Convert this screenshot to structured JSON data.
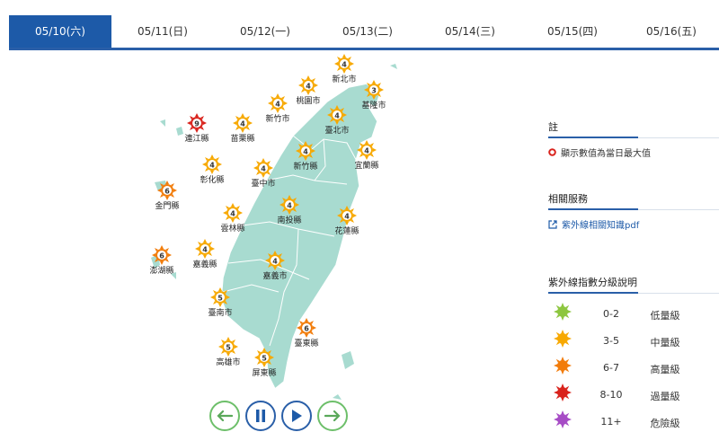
{
  "tabs": [
    {
      "label": "05/10(六)",
      "active": true
    },
    {
      "label": "05/11(日)",
      "active": false
    },
    {
      "label": "05/12(一)",
      "active": false
    },
    {
      "label": "05/13(二)",
      "active": false
    },
    {
      "label": "05/14(三)",
      "active": false
    },
    {
      "label": "05/15(四)",
      "active": false
    },
    {
      "label": "05/16(五)",
      "active": false
    }
  ],
  "colors": {
    "tab_active": "#1d5aa8",
    "land": "#a8dbd0",
    "low": "#8dc63f",
    "mid": "#f7a800",
    "high": "#f27c0a",
    "excess": "#d9231c",
    "danger": "#a64bc5"
  },
  "cities": [
    {
      "name": "新北市",
      "value": "4",
      "level": "mid"
    },
    {
      "name": "桃園市",
      "value": "4",
      "level": "mid"
    },
    {
      "name": "基隆市",
      "value": "3",
      "level": "mid"
    },
    {
      "name": "新竹市",
      "value": "4",
      "level": "mid"
    },
    {
      "name": "臺北市",
      "value": "4",
      "level": "mid"
    },
    {
      "name": "連江縣",
      "value": "9",
      "level": "excess"
    },
    {
      "name": "苗栗縣",
      "value": "4",
      "level": "mid"
    },
    {
      "name": "新竹縣",
      "value": "4",
      "level": "mid"
    },
    {
      "name": "宜蘭縣",
      "value": "4",
      "level": "mid"
    },
    {
      "name": "彰化縣",
      "value": "4",
      "level": "mid"
    },
    {
      "name": "臺中市",
      "value": "4",
      "level": "mid"
    },
    {
      "name": "金門縣",
      "value": "6",
      "level": "high"
    },
    {
      "name": "南投縣",
      "value": "4",
      "level": "mid"
    },
    {
      "name": "雲林縣",
      "value": "4",
      "level": "mid"
    },
    {
      "name": "花蓮縣",
      "value": "4",
      "level": "mid"
    },
    {
      "name": "澎湖縣",
      "value": "6",
      "level": "high"
    },
    {
      "name": "嘉義縣",
      "value": "4",
      "level": "mid"
    },
    {
      "name": "嘉義市",
      "value": "4",
      "level": "mid"
    },
    {
      "name": "臺南市",
      "value": "5",
      "level": "mid"
    },
    {
      "name": "臺東縣",
      "value": "6",
      "level": "high"
    },
    {
      "name": "高雄市",
      "value": "5",
      "level": "mid"
    },
    {
      "name": "屏東縣",
      "value": "5",
      "level": "mid"
    }
  ],
  "controls": {
    "prev": "left-arrow-icon",
    "pause": "pause-icon",
    "play": "play-icon",
    "next": "right-arrow-icon"
  },
  "note": {
    "title": "註",
    "text": "顯示數值為當日最大值"
  },
  "services": {
    "title": "相關服務",
    "link": "紫外線相關知識pdf"
  },
  "legend": {
    "title": "紫外線指數分級說明",
    "items": [
      {
        "range": "0-2",
        "label": "低量級",
        "level": "low"
      },
      {
        "range": "3-5",
        "label": "中量級",
        "level": "mid"
      },
      {
        "range": "6-7",
        "label": "高量級",
        "level": "high"
      },
      {
        "range": "8-10",
        "label": "過量級",
        "level": "excess"
      },
      {
        "range": "11+",
        "label": "危險級",
        "level": "danger"
      }
    ]
  }
}
